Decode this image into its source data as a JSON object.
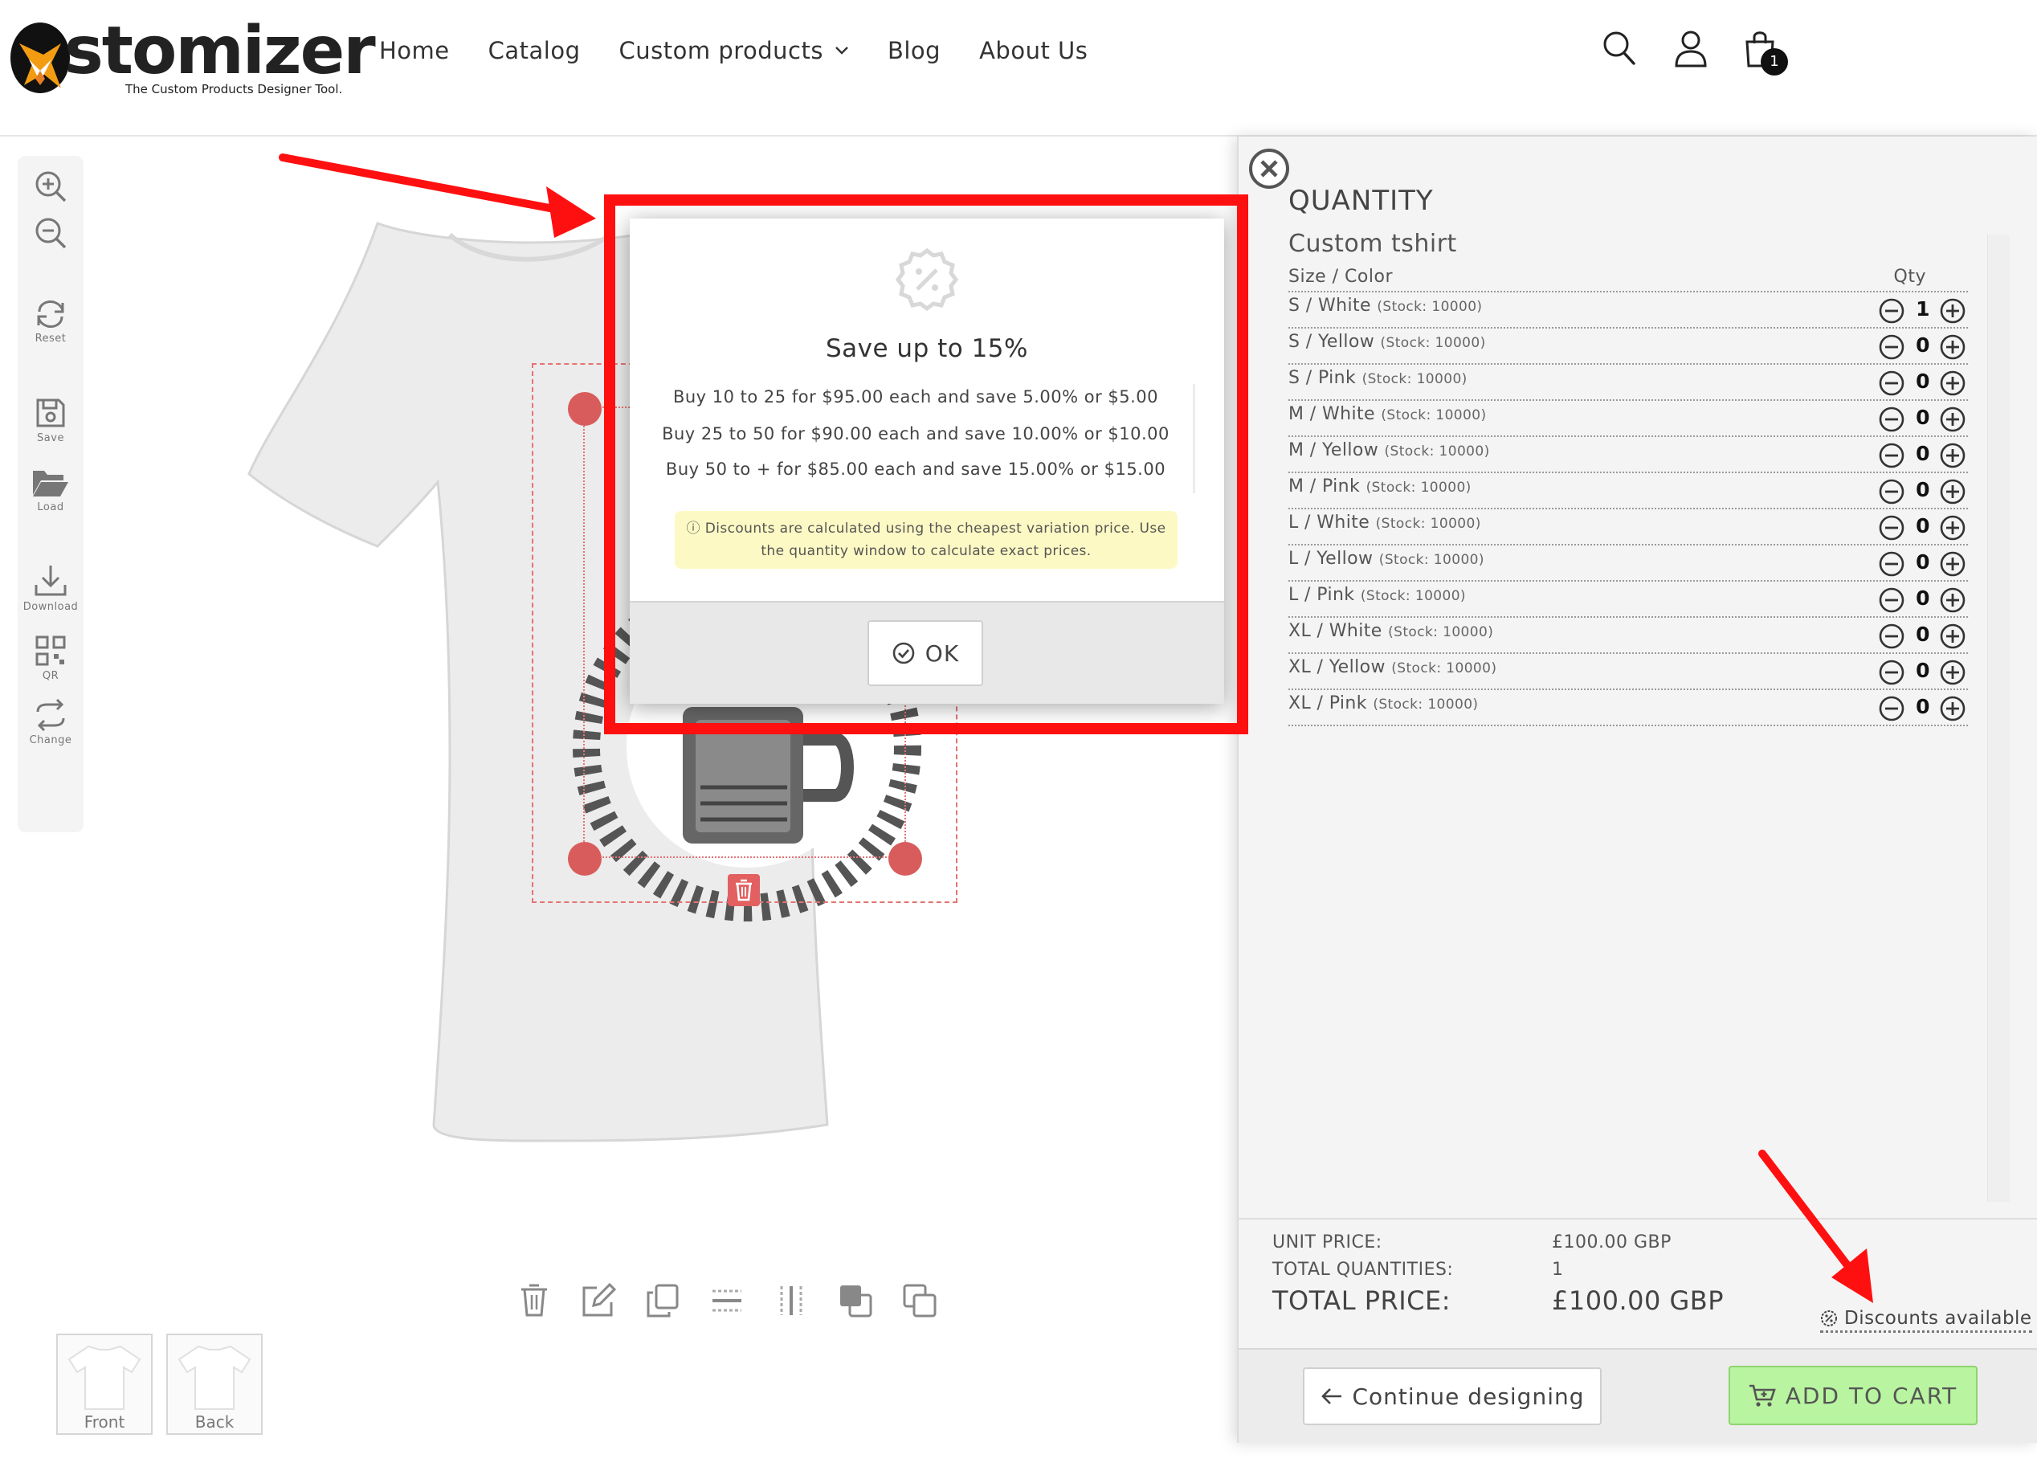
{
  "header": {
    "logo_word": "stomizer",
    "logo_tagline": "The Custom Products Designer Tool.",
    "nav": [
      {
        "label": "Home"
      },
      {
        "label": "Catalog"
      },
      {
        "label": "Custom products",
        "has_dropdown": true
      },
      {
        "label": "Blog"
      },
      {
        "label": "About Us"
      }
    ],
    "cart_count": "1"
  },
  "toolbar": {
    "reset": "Reset",
    "save": "Save",
    "load": "Load",
    "download": "Download",
    "qr": "QR",
    "change": "Change"
  },
  "views": [
    {
      "label": "Front"
    },
    {
      "label": "Back"
    }
  ],
  "modal": {
    "title": "Save up to 15%",
    "tiers": [
      "Buy 10 to 25 for $95.00 each and save 5.00% or $5.00",
      "Buy 25 to 50 for $90.00 each and save 10.00% or $10.00",
      "Buy 50 to + for $85.00 each and save 15.00% or $15.00"
    ],
    "note_line1": "Discounts are calculated using the cheapest variation price. Use",
    "note_line2": "the quantity window to calculate exact prices.",
    "ok_label": "OK"
  },
  "panel": {
    "title": "QUANTITY",
    "product": "Custom tshirt",
    "col_option": "Size / Color",
    "col_qty": "Qty",
    "rows": [
      {
        "option": "S / White",
        "stock": "(Stock: 10000)",
        "qty": "1"
      },
      {
        "option": "S / Yellow",
        "stock": "(Stock: 10000)",
        "qty": "0"
      },
      {
        "option": "S / Pink",
        "stock": "(Stock: 10000)",
        "qty": "0"
      },
      {
        "option": "M / White",
        "stock": "(Stock: 10000)",
        "qty": "0"
      },
      {
        "option": "M / Yellow",
        "stock": "(Stock: 10000)",
        "qty": "0"
      },
      {
        "option": "M / Pink",
        "stock": "(Stock: 10000)",
        "qty": "0"
      },
      {
        "option": "L / White",
        "stock": "(Stock: 10000)",
        "qty": "0"
      },
      {
        "option": "L / Yellow",
        "stock": "(Stock: 10000)",
        "qty": "0"
      },
      {
        "option": "L / Pink",
        "stock": "(Stock: 10000)",
        "qty": "0"
      },
      {
        "option": "XL / White",
        "stock": "(Stock: 10000)",
        "qty": "0"
      },
      {
        "option": "XL / Yellow",
        "stock": "(Stock: 10000)",
        "qty": "0"
      },
      {
        "option": "XL / Pink",
        "stock": "(Stock: 10000)",
        "qty": "0"
      }
    ],
    "unit_price_label": "UNIT PRICE:",
    "unit_price": "£100.00 GBP",
    "total_qty_label": "TOTAL QUANTITIES:",
    "total_qty": "1",
    "total_price_label": "TOTAL PRICE:",
    "total_price": "£100.00 GBP",
    "discounts_link": "Discounts available",
    "continue_label": "Continue designing",
    "add_to_cart_label": "ADD TO CART"
  },
  "colors": {
    "annotation_red": "#ff1010",
    "handle_red": "#d95c5c",
    "note_yellow": "#fdf9c4",
    "cart_green": "#b9f5a0"
  }
}
